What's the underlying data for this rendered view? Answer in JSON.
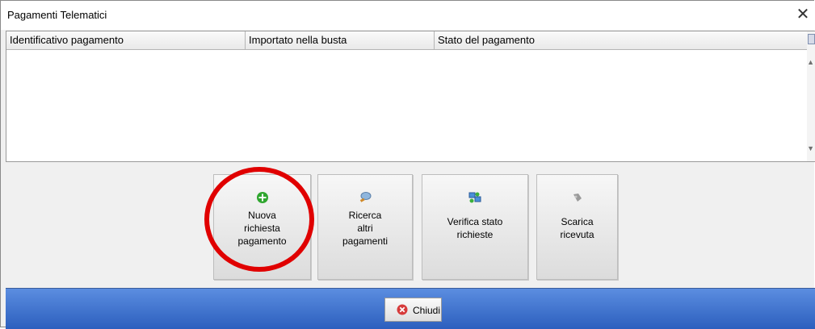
{
  "window": {
    "title": "Pagamenti Telematici",
    "close_glyph": "✕"
  },
  "grid": {
    "columns": [
      "Identificativo pagamento",
      "Importato nella busta",
      "Stato del pagamento"
    ],
    "rows": []
  },
  "actions": {
    "nuova": [
      "Nuova",
      "richiesta",
      "pagamento"
    ],
    "ricerca": [
      "Ricerca",
      "altri",
      "pagamenti"
    ],
    "verifica": [
      "Verifica stato",
      "richieste"
    ],
    "scarica": [
      "Scarica",
      "ricevuta"
    ]
  },
  "footer": {
    "close_label": "Chiudi"
  },
  "colors": {
    "footer": "#3f72d2",
    "highlight": "#e00000",
    "add_green": "#2fa62f",
    "close_red": "#d63a3a"
  },
  "icons": {
    "add": "plus-circle-icon",
    "search": "search-icon",
    "verify": "network-computers-icon",
    "download": "download-icon",
    "close": "close-circle-icon"
  }
}
